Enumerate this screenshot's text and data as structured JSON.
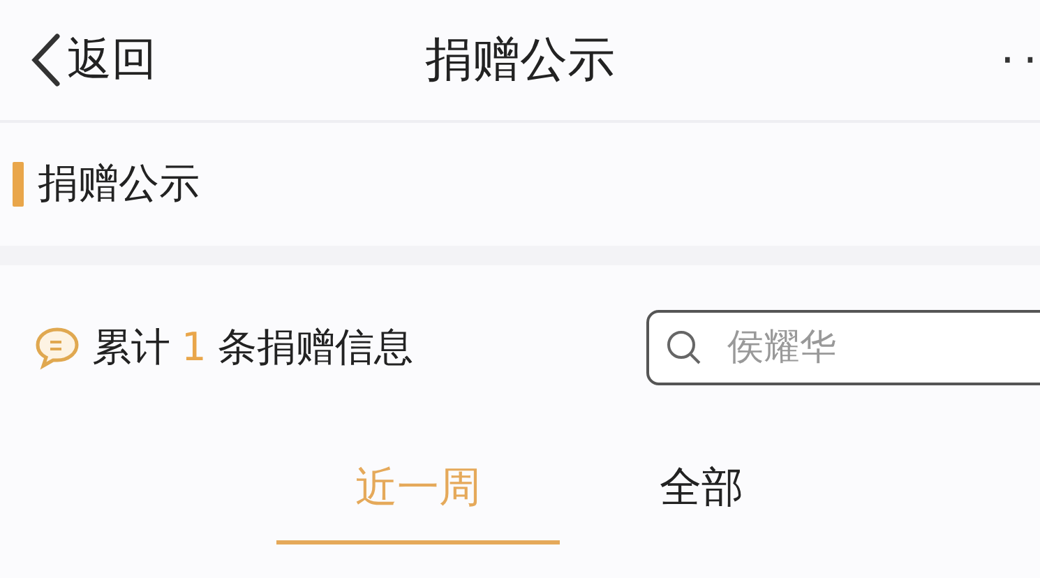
{
  "nav": {
    "back": "返回",
    "title": "捐赠公示",
    "more": "··"
  },
  "section": {
    "title": "捐赠公示"
  },
  "summary": {
    "prefix": "累计",
    "count": "1",
    "suffix": "条捐赠信息"
  },
  "search": {
    "placeholder": "侯耀华"
  },
  "tabs": [
    {
      "label": "近一周",
      "selected": true
    },
    {
      "label": "全部",
      "selected": false
    }
  ]
}
